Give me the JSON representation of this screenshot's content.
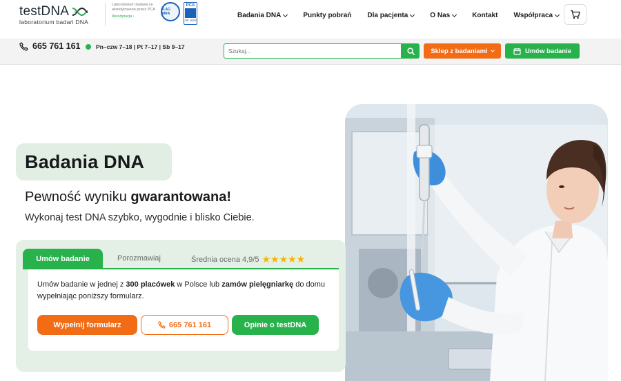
{
  "header": {
    "logo": {
      "name": "testDNA",
      "subtitle": "laboratorium badań DNA"
    },
    "accreditation": {
      "text": "Laboratorium badawcze akredytowane przez PCA",
      "link": "Akredytacja ›",
      "seal_label": "ILAC-MRA",
      "pca_label": "PCA",
      "pca_code": "AB 1618"
    },
    "nav": [
      {
        "label": "Badania DNA",
        "has_dropdown": true
      },
      {
        "label": "Punkty pobrań",
        "has_dropdown": false
      },
      {
        "label": "Dla pacjenta",
        "has_dropdown": true
      },
      {
        "label": "O Nas",
        "has_dropdown": true
      },
      {
        "label": "Kontakt",
        "has_dropdown": false
      },
      {
        "label": "Współpraca",
        "has_dropdown": true
      }
    ],
    "cart_icon": "cart-icon"
  },
  "subbar": {
    "phone": "665 761 161",
    "hours": "Pn–czw 7–18 | Pt 7–17 | Sb 9–17",
    "search_placeholder": "Szukaj...",
    "shop_label": "Sklep z badaniami",
    "book_label": "Umów badanie"
  },
  "hero": {
    "title": "Badania DNA",
    "tagline_prefix": "Pewność wyniku ",
    "tagline_bold": "gwarantowana!",
    "lead": "Wykonaj test DNA szybko, wygodnie i blisko Ciebie."
  },
  "booking": {
    "tabs": {
      "active": "Umów badanie",
      "chat": "Porozmawiaj",
      "rating": "Średnia ocena 4,9/5",
      "stars": 5
    },
    "desc": {
      "part1": "Umów badanie w jednej z ",
      "bold1": "300 placówek",
      "part2": " w Polsce lub ",
      "bold2": "zamów pielęgniarkę",
      "part3": " do domu wypełniając poniższy formularz."
    },
    "buttons": {
      "form": "Wypełnij formularz",
      "phone": "665 761 161",
      "opinions": "Opinie o testDNA"
    }
  },
  "colors": {
    "green": "#28b24b",
    "orange": "#f26c16",
    "panel": "#e4efe5"
  }
}
